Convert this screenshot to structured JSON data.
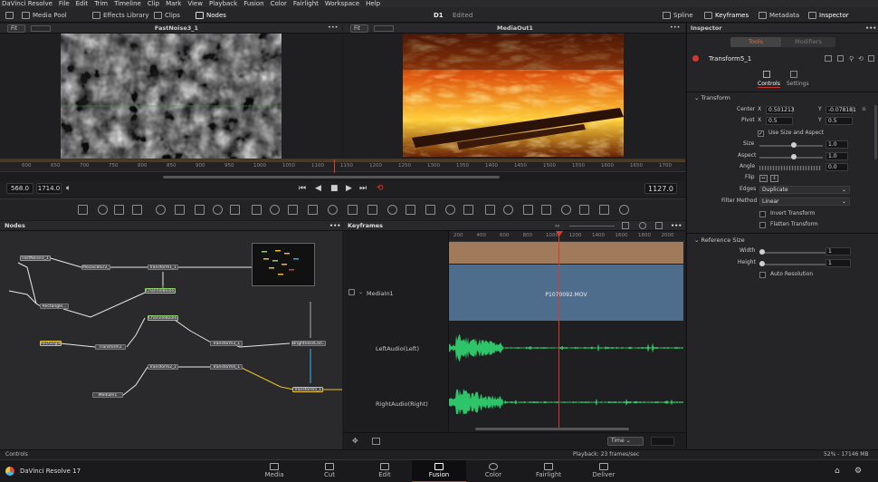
{
  "menu": [
    "DaVinci Resolve",
    "File",
    "Edit",
    "Trim",
    "Timeline",
    "Clip",
    "Mark",
    "View",
    "Playback",
    "Fusion",
    "Color",
    "Fairlight",
    "Workspace",
    "Help"
  ],
  "toolbar": {
    "media_pool": "Media Pool",
    "effects_library": "Effects Library",
    "clips": "Clips",
    "nodes": "Nodes",
    "project_title": "D1",
    "edit_status": "Edited",
    "spline": "Spline",
    "keyframes": "Keyframes",
    "metadata": "Metadata",
    "inspector": "Inspector"
  },
  "viewer_left": {
    "fit": "Fit",
    "title": "FastNoise3_1",
    "more": "•••"
  },
  "viewer_right": {
    "fit": "Fit",
    "title": "MediaOut1",
    "more": "•••"
  },
  "ruler_ticks": [
    "600",
    "650",
    "700",
    "750",
    "800",
    "850",
    "900",
    "950",
    "1000",
    "1050",
    "1100",
    "1150",
    "1200",
    "1250",
    "1300",
    "1350",
    "1400",
    "1450",
    "1500",
    "1550",
    "1600",
    "1650",
    "1700",
    "1750"
  ],
  "transport": {
    "in_point": "568.0",
    "out_point": "1714.0",
    "current_frame": "1127.0"
  },
  "nodes_panel": {
    "title": "Nodes",
    "more": "•••",
    "nodes": [
      "FastNoise3_1",
      "MosaicBlur2_1",
      "Transform1_1",
      "ChannelBoole...",
      "Rectangle...",
      "Rectangle...",
      "Transform1",
      "ChannelBoole...",
      "Transform3_1",
      "BrightnessCon...",
      "Transform2_1",
      "Transform4_1",
      "MediaIn1",
      "Transform5_1"
    ]
  },
  "keyframes_panel": {
    "title": "Keyframes",
    "more": "•••",
    "ticks": [
      "200",
      "400",
      "600",
      "800",
      "1000",
      "1200",
      "1400",
      "1600",
      "1800",
      "2000"
    ],
    "tracks": [
      "MediaIn1",
      "LeftAudio(Left)",
      "RightAudio(Right)"
    ],
    "clip_name": "P1070092.MOV",
    "time_mode": "Time"
  },
  "inspector": {
    "title": "Inspector",
    "tabs": [
      "Tools",
      "Modifiers"
    ],
    "tool_name": "Transform5_1",
    "subtabs": [
      "Controls",
      "Settings"
    ],
    "section_transform": "Transform",
    "center_label": "Center",
    "center_x": "0.501213",
    "center_y": "-0.078181",
    "pivot_label": "Pivot",
    "pivot_x": "0.5",
    "pivot_y": "0.5",
    "use_size_aspect": "Use Size and Aspect",
    "size_label": "Size",
    "size_value": "1.0",
    "aspect_label": "Aspect",
    "aspect_value": "1.0",
    "angle_label": "Angle",
    "angle_value": "0.0",
    "flip_label": "Flip",
    "edges_label": "Edges",
    "edges_value": "Duplicate",
    "filter_label": "Filter Method",
    "filter_value": "Linear",
    "invert_transform": "Invert Transform",
    "flatten_transform": "Flatten Transform",
    "section_reference": "Reference Size",
    "width_label": "Width",
    "width_value": "1",
    "height_label": "Height",
    "height_value": "1",
    "auto_resolution": "Auto Resolution",
    "x_label": "X",
    "y_label": "Y"
  },
  "status": {
    "left": "Controls",
    "center": "Playback: 23 frames/sec",
    "right": "52% - 17146 MB"
  },
  "app_name": "DaVinci Resolve 17",
  "pages": [
    "Media",
    "Cut",
    "Edit",
    "Fusion",
    "Color",
    "Fairlight",
    "Deliver"
  ],
  "active_page": "Fusion"
}
